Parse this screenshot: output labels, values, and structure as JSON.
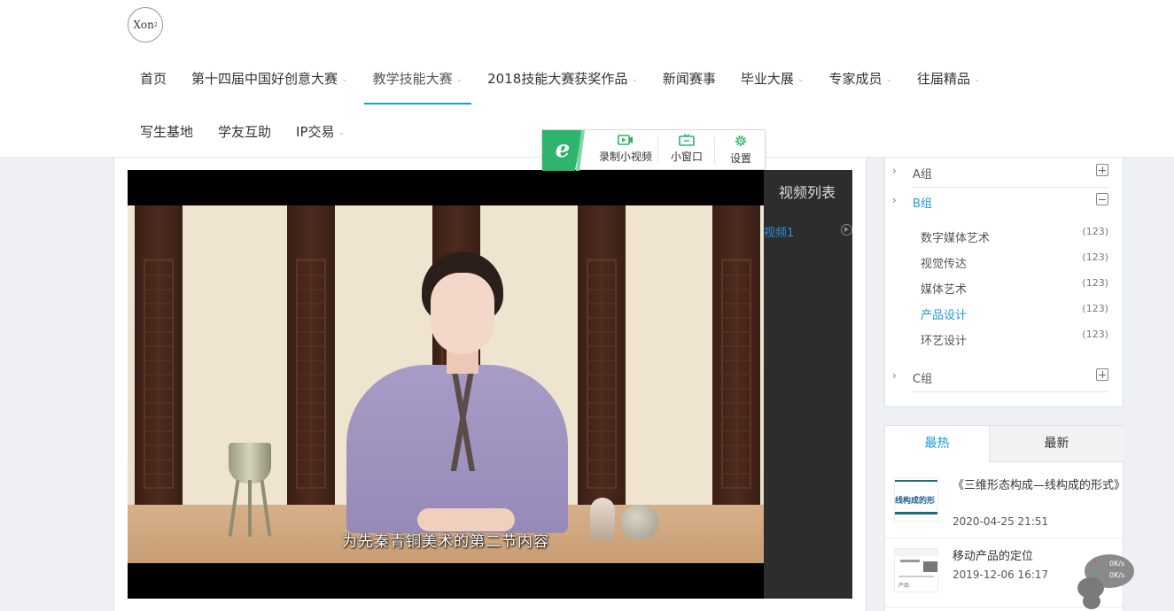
{
  "logo": {
    "text": "Xon",
    "sup": "2"
  },
  "nav": {
    "row1": [
      {
        "label": "首页",
        "caret": false
      },
      {
        "label": "第十四届中国好创意大赛",
        "caret": true
      },
      {
        "label": "教学技能大赛",
        "caret": true,
        "active": true
      },
      {
        "label": "2018技能大赛获奖作品",
        "caret": true
      },
      {
        "label": "新闻赛事",
        "caret": false
      },
      {
        "label": "毕业大展",
        "caret": true
      },
      {
        "label": "专家成员",
        "caret": true
      },
      {
        "label": "往届精品",
        "caret": true
      }
    ],
    "row2": [
      {
        "label": "写生基地",
        "caret": false
      },
      {
        "label": "学友互助",
        "caret": false
      },
      {
        "label": "IP交易",
        "caret": true
      }
    ],
    "caret_glyph": "⌄"
  },
  "browser_toolbar": {
    "logo_letter": "e",
    "record": "录制小视频",
    "mini_window": "小窗口",
    "settings": "设置",
    "accent": "#2fb46e"
  },
  "player": {
    "subtitle": "为先秦青铜美术的第二节内容",
    "list_title": "视频列表",
    "items": [
      {
        "label": "视频1"
      }
    ]
  },
  "categories": {
    "chev": "›",
    "groups": [
      {
        "name": "A组",
        "expanded": false
      },
      {
        "name": "B组",
        "expanded": true
      },
      {
        "name": "C组",
        "expanded": false
      }
    ],
    "b_items": [
      {
        "name": "数字媒体艺术",
        "count": "(123)"
      },
      {
        "name": "视觉传达",
        "count": "(123)"
      },
      {
        "name": "媒体艺术",
        "count": "(123)"
      },
      {
        "name": "产品设计",
        "count": "(123)",
        "selected": true
      },
      {
        "name": "环艺设计",
        "count": "(123)"
      }
    ]
  },
  "tabs": {
    "hot": "最热",
    "new": "最新"
  },
  "articles": [
    {
      "title": "《三维形态构成—线构成的形式》",
      "date": "2020-04-25 21:51",
      "thumb_text": "线构成的形"
    },
    {
      "title": "移动产品的定位",
      "date": "2019-12-06 16:17",
      "thumb_text": "产品"
    }
  ],
  "speed": {
    "up": "0K/s",
    "down": "0K/s"
  },
  "colors": {
    "accent": "#1a9bd7",
    "green": "#2fb46e"
  }
}
